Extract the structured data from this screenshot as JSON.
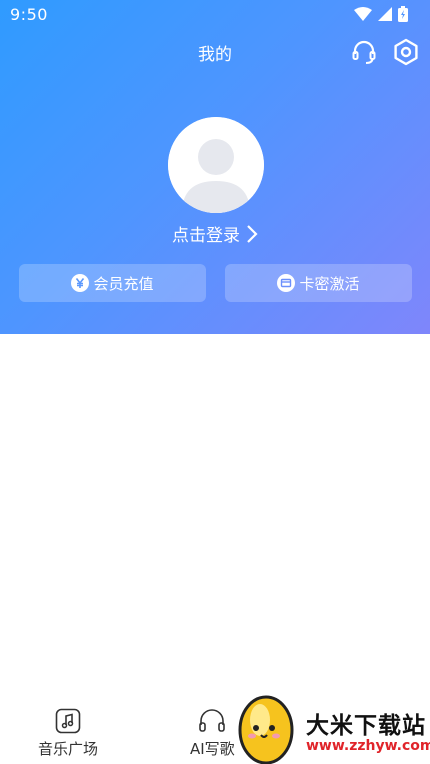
{
  "status": {
    "time": "9:50"
  },
  "header": {
    "title": "我的"
  },
  "profile": {
    "login_label": "点击登录"
  },
  "actions": [
    {
      "label": "会员充值",
      "icon": "yen-circle-icon"
    },
    {
      "label": "卡密激活",
      "icon": "card-icon"
    }
  ],
  "tabs": [
    {
      "label": "音乐广场",
      "icon": "music-note-icon"
    },
    {
      "label": "AI写歌",
      "icon": "headphones-icon"
    }
  ],
  "watermark": {
    "title": "大米下载站",
    "url": "www.zzhyw.com"
  },
  "colors": {
    "header_start": "#2f9bff",
    "header_end": "#7f86fb",
    "watermark_url": "#e0242a"
  }
}
